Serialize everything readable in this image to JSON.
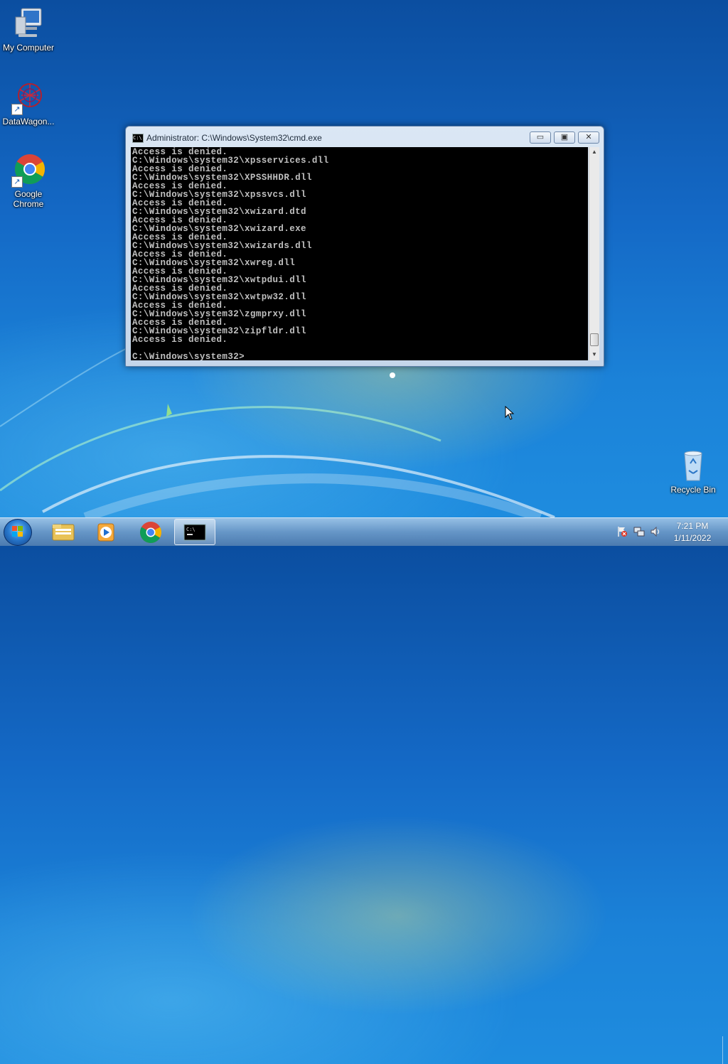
{
  "desktop": {
    "icons": [
      {
        "label": "My Computer",
        "icon": "computer-icon"
      },
      {
        "label": "DataWagon...",
        "icon": "datawagon-icon"
      },
      {
        "label": "Google Chrome",
        "icon": "chrome-icon"
      },
      {
        "label": "Recycle Bin",
        "icon": "recycle-bin-icon"
      }
    ]
  },
  "window": {
    "title": "Administrator: C:\\Windows\\System32\\cmd.exe",
    "minimize_glyph": "▭",
    "maximize_glyph": "▣",
    "close_glyph": "✕",
    "console_text": "Access is denied.\nC:\\Windows\\system32\\xpsservices.dll\nAccess is denied.\nC:\\Windows\\system32\\XPSSHHDR.dll\nAccess is denied.\nC:\\Windows\\system32\\xpssvcs.dll\nAccess is denied.\nC:\\Windows\\system32\\xwizard.dtd\nAccess is denied.\nC:\\Windows\\system32\\xwizard.exe\nAccess is denied.\nC:\\Windows\\system32\\xwizards.dll\nAccess is denied.\nC:\\Windows\\system32\\xwreg.dll\nAccess is denied.\nC:\\Windows\\system32\\xwtpdui.dll\nAccess is denied.\nC:\\Windows\\system32\\xwtpw32.dll\nAccess is denied.\nC:\\Windows\\system32\\zgmprxy.dll\nAccess is denied.\nC:\\Windows\\system32\\zipfldr.dll\nAccess is denied.\n\nC:\\Windows\\system32>"
  },
  "taskbar": {
    "pinned": [
      {
        "name": "windows-explorer"
      },
      {
        "name": "media-player"
      },
      {
        "name": "google-chrome"
      },
      {
        "name": "command-prompt",
        "active": true
      }
    ],
    "clock": {
      "time": "7:21 PM",
      "date": "1/11/2022"
    }
  }
}
